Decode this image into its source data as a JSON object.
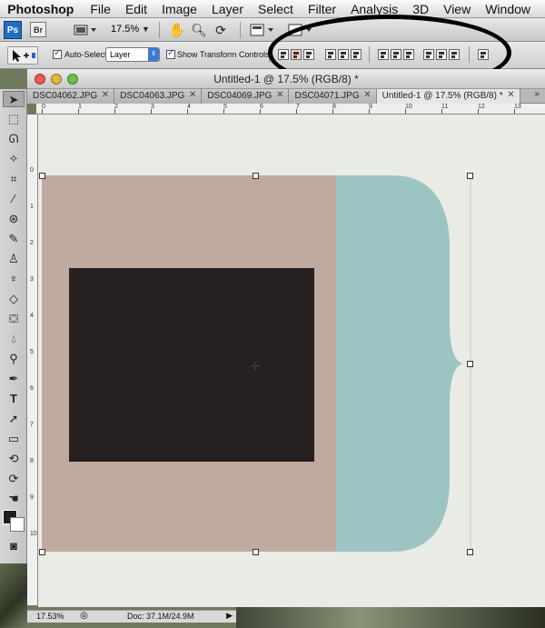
{
  "menubar": {
    "app_name": "Photoshop",
    "items": [
      "File",
      "Edit",
      "Image",
      "Layer",
      "Select",
      "Filter",
      "Analysis",
      "3D",
      "View",
      "Window"
    ]
  },
  "appbar": {
    "ps_badge": "Ps",
    "br_badge": "Br",
    "zoom": "17.5%"
  },
  "options": {
    "auto_select_label": "Auto-Select:",
    "auto_select_value": "Layer",
    "show_transform_label": "Show Transform Controls"
  },
  "document": {
    "title": "Untitled-1 @ 17.5% (RGB/8) *",
    "tabs": [
      "DSC04062.JPG",
      "DSC04063.JPG",
      "DSC04069.JPG",
      "DSC04071.JPG",
      "Untitled-1 @ 17.5% (RGB/8) *"
    ],
    "active_tab": 4,
    "ruler_top": [
      "0",
      "1",
      "2",
      "3",
      "4",
      "5",
      "6",
      "7",
      "8",
      "9",
      "10",
      "11",
      "12",
      "13"
    ],
    "ruler_left": [
      "0",
      "1",
      "2",
      "3",
      "4",
      "5",
      "6",
      "7",
      "8",
      "9",
      "10"
    ]
  },
  "colors": {
    "shape_brown": "#c0aa9f",
    "shape_dark": "#272020",
    "shape_teal": "#9cc4c2",
    "canvas_bg": "#e9ebe5",
    "foreground": "#1f1f1f",
    "background": "#ffffff"
  },
  "status": {
    "zoom": "17.53%",
    "doc_size": "Doc: 37.1M/24.9M"
  },
  "icons": {
    "tools": [
      "move-tool-icon",
      "marquee-tool-icon",
      "lasso-tool-icon",
      "magic-wand-icon",
      "crop-tool-icon",
      "eyedropper-icon",
      "healing-brush-icon",
      "brush-tool-icon",
      "clone-stamp-icon",
      "history-brush-icon",
      "eraser-icon",
      "paint-bucket-icon",
      "blur-tool-icon",
      "dodge-tool-icon",
      "pen-tool-icon",
      "type-tool-icon",
      "path-selection-icon",
      "rectangle-tool-icon",
      "3d-rotate-icon",
      "3d-orbit-icon",
      "hand-tool-icon",
      "zoom-tool-icon"
    ]
  }
}
